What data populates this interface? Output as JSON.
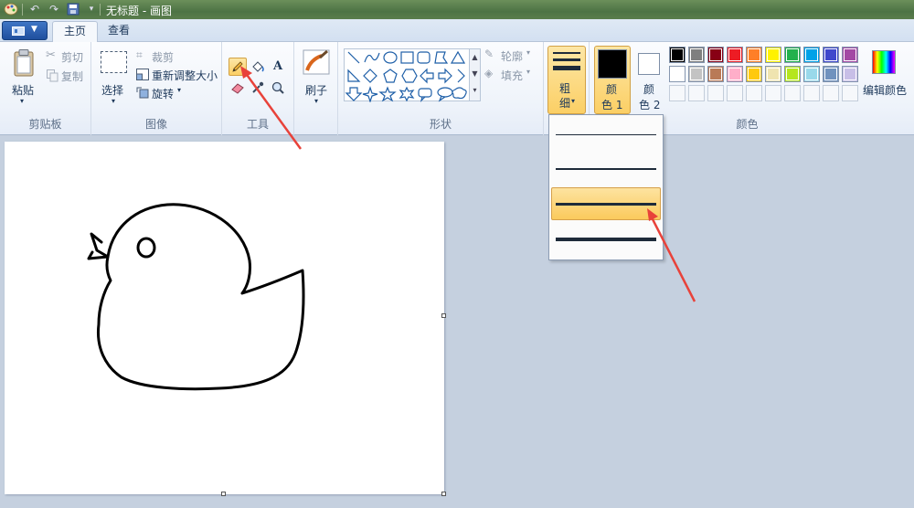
{
  "window": {
    "title": "无标题 - 画图"
  },
  "tabs": [
    {
      "label": "主页",
      "active": true
    },
    {
      "label": "查看",
      "active": false
    }
  ],
  "clipboard": {
    "paste_label": "粘贴",
    "cut_label": "剪切",
    "copy_label": "复制",
    "group_label": "剪贴板"
  },
  "image": {
    "select_label": "选择",
    "crop_label": "裁剪",
    "resize_label": "重新调整大小",
    "rotate_label": "旋转",
    "group_label": "图像"
  },
  "tools": {
    "group_label": "工具",
    "selected_tool": "pencil",
    "items": [
      "pencil-icon",
      "fill-icon",
      "text-icon",
      "eraser-icon",
      "color-picker-icon",
      "magnifier-icon"
    ]
  },
  "brushes": {
    "label": "刷子"
  },
  "shapes": {
    "outline_label": "轮廓",
    "fill_label": "填充",
    "group_label": "形状"
  },
  "size": {
    "label_top": "粗",
    "label_bottom": "细",
    "options": [
      "1px",
      "3px",
      "5px",
      "8px"
    ],
    "highlighted_index": 2
  },
  "colors": {
    "color1_top": "颜",
    "color1_bottom": "色 1",
    "color2_top": "颜",
    "color2_bottom": "色 2",
    "edit_label": "编辑颜色",
    "group_label": "颜色",
    "color1_value": "#000000",
    "color2_value": "#ffffff",
    "palette_row1": [
      "#000000",
      "#7f7f7f",
      "#880015",
      "#ed1c24",
      "#ff7f27",
      "#fff200",
      "#22b14c",
      "#00a2e8",
      "#3f48cc",
      "#a349a4"
    ],
    "palette_row2": [
      "#ffffff",
      "#c3c3c3",
      "#b97a57",
      "#ffaec9",
      "#ffc90e",
      "#efe4b0",
      "#b5e61d",
      "#99d9ea",
      "#7092be",
      "#c8bfe7"
    ]
  },
  "accent": {
    "selection": "#fbcf65",
    "annotation_arrow": "#e8423a"
  }
}
